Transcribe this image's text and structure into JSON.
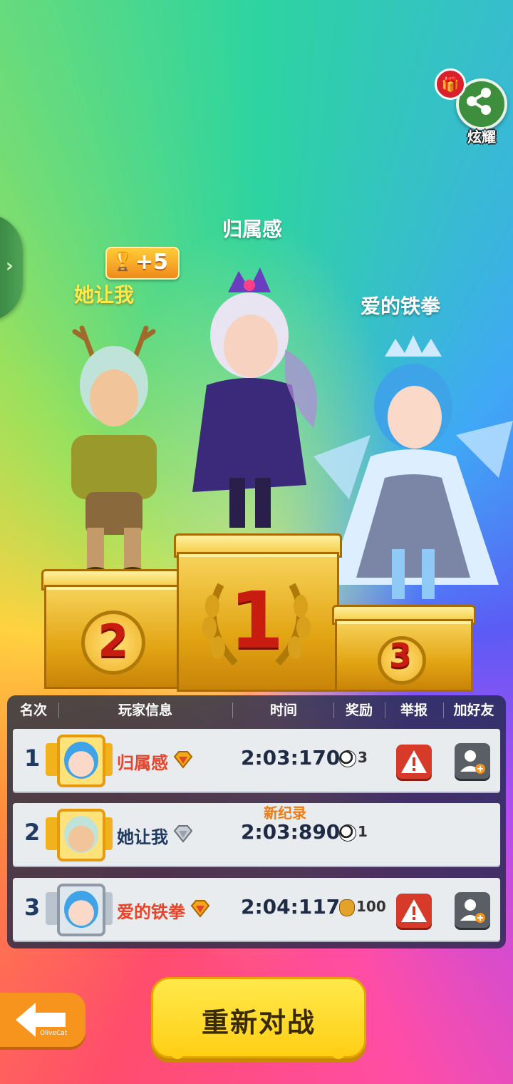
{
  "share": {
    "label": "炫耀",
    "gift_icon": "gift-icon",
    "share_icon": "share-icon"
  },
  "podium": {
    "first": {
      "name": "归属感"
    },
    "second": {
      "name": "她让我",
      "bonus": "+5"
    },
    "third": {
      "name": "爱的铁拳"
    },
    "numbers": [
      "1",
      "2",
      "3"
    ]
  },
  "table": {
    "headers": [
      "名次",
      "玩家信息",
      "时间",
      "奖励",
      "举报",
      "加好友"
    ],
    "rows": [
      {
        "rank": "1",
        "name": "归属感",
        "time": "2:03:170",
        "reward": "3",
        "reward_icon": "soccer-ball-icon",
        "report": "!",
        "new_record": ""
      },
      {
        "rank": "2",
        "name": "她让我",
        "time": "2:03:890",
        "reward": "1",
        "reward_icon": "soccer-ball-icon",
        "report": "",
        "new_record": "新纪录"
      },
      {
        "rank": "3",
        "name": "爱的铁拳",
        "time": "2:04:117",
        "reward": "100",
        "reward_icon": "coin-bag-icon",
        "report": "!",
        "new_record": ""
      }
    ]
  },
  "buttons": {
    "rematch": "重新对战",
    "back_watermark": "OliveCat"
  },
  "colors": {
    "name_red": "#e4452c",
    "name_dark": "#1f3a63",
    "accent_yellow": "#ffcf16",
    "report_red": "#d83a2a"
  }
}
